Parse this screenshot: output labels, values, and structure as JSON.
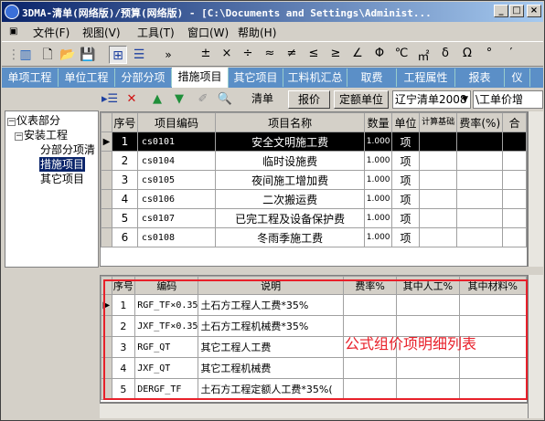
{
  "window": {
    "title": "3DMA-清单(网络版)/预算(网络版) - [C:\\Documents and Settings\\Administ...",
    "minimize": "_",
    "maximize": "□",
    "close": "×"
  },
  "menu": [
    "文件(F)",
    "视图(V)",
    "工具(T)",
    "窗口(W)",
    "帮助(H)"
  ],
  "symbols": [
    "±",
    "×",
    "÷",
    "≈",
    "≠",
    "≤",
    "≥",
    "∠",
    "Φ",
    "℃",
    "㎡",
    "δ",
    "Ω",
    "°",
    "′"
  ],
  "tabs": [
    "单项工程",
    "单位工程",
    "分部分项",
    "措施项目",
    "其它项目",
    "工料机汇总",
    "取费",
    "工程属性",
    "报表",
    "仪"
  ],
  "active_tab": "措施项目",
  "subtoolbar": {
    "clear_label": "清单",
    "price_label": "报价",
    "quota_unit_label": "定额单位",
    "region_select": "辽宁清单2008",
    "work_price_select": "\\工单价增"
  },
  "tree": {
    "root": "仪表部分",
    "child": "安装工程",
    "items": [
      "分部分项清",
      "措施项目",
      "其它项目"
    ],
    "selected": "措施项目"
  },
  "upper_table": {
    "headers": [
      "序号",
      "项目编码",
      "项目名称",
      "数量",
      "单位",
      "计算基础",
      "费率(%)",
      "合"
    ],
    "rows": [
      [
        "1",
        "cs0101",
        "安全文明施工费",
        "1.000",
        "项"
      ],
      [
        "2",
        "cs0104",
        "临时设施费",
        "1.000",
        "项"
      ],
      [
        "3",
        "cs0105",
        "夜间施工增加费",
        "1.000",
        "项"
      ],
      [
        "4",
        "cs0106",
        "二次搬运费",
        "1.000",
        "项"
      ],
      [
        "5",
        "cs0107",
        "已完工程及设备保护费",
        "1.000",
        "项"
      ],
      [
        "6",
        "cs0108",
        "冬雨季施工费",
        "1.000",
        "项"
      ]
    ]
  },
  "lower_table": {
    "headers": [
      "序号",
      "编码",
      "说明",
      "费率%",
      "其中人工%",
      "其中材料%"
    ],
    "rows": [
      [
        "1",
        "RGF_TF×0.35",
        "土石方工程人工费*35%"
      ],
      [
        "2",
        "JXF_TF×0.35",
        "土石方工程机械费*35%"
      ],
      [
        "3",
        "RGF_QT",
        "其它工程人工费"
      ],
      [
        "4",
        "JXF_QT",
        "其它工程机械费"
      ],
      [
        "5",
        "DERGF_TF",
        "土石方工程定额人工费*35%("
      ]
    ]
  },
  "annotation": "公式组价项明细列表",
  "colors": {
    "title_start": "#0a246a",
    "tab_bar": "#5b8fc7",
    "selection": "#0a246a",
    "annotation": "#e8202a"
  }
}
